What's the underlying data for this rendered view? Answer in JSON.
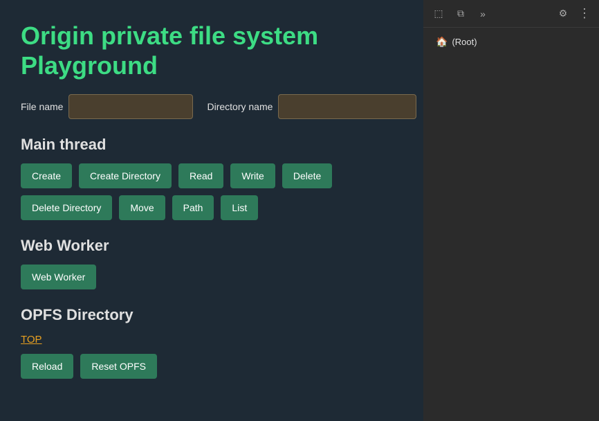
{
  "page": {
    "title_line1": "Origin private file system",
    "title_line2": "Playground"
  },
  "inputs": {
    "file_name_label": "File name",
    "file_name_placeholder": "",
    "directory_name_label": "Directory name",
    "directory_name_placeholder": ""
  },
  "main_thread": {
    "section_title": "Main thread",
    "row1": [
      "Create",
      "Create Directory",
      "Read",
      "Write",
      "Delete"
    ],
    "row2": [
      "Delete Directory",
      "Move",
      "Path",
      "List"
    ]
  },
  "web_worker": {
    "section_title": "Web Worker",
    "button_label": "Web Worker"
  },
  "opfs_directory": {
    "section_title": "OPFS Directory",
    "top_link": "TOP",
    "reload_label": "Reload",
    "reset_label": "Reset OPFS"
  },
  "right_panel": {
    "tree_root_label": "(Root)",
    "tree_root_icon": "🏠"
  },
  "toolbar": {
    "icon1": "⬚",
    "icon2": "⧉",
    "icon3": "»",
    "icon4": "⚙",
    "icon5": "⋮"
  }
}
